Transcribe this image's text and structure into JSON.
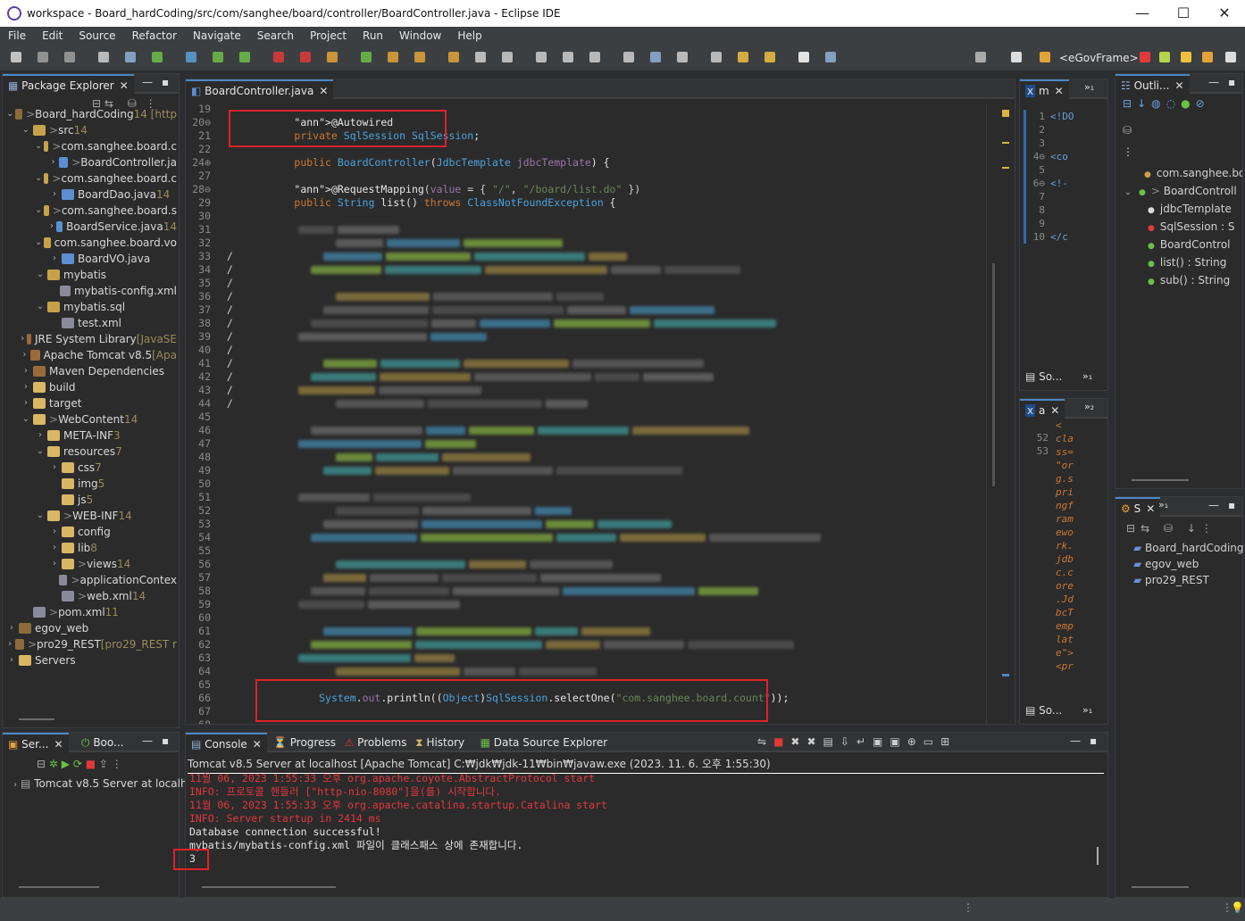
{
  "window": {
    "title": "workspace - Board_hardCoding/src/com/sanghee/board/controller/BoardController.java - Eclipse IDE",
    "min": "—",
    "max": "☐",
    "close": "✕"
  },
  "menu": [
    "File",
    "Edit",
    "Source",
    "Refactor",
    "Navigate",
    "Search",
    "Project",
    "Run",
    "Window",
    "Help"
  ],
  "toolbar": {
    "perspective": "<eGovFrame>"
  },
  "package_explorer": {
    "title": "Package Explorer",
    "items": [
      {
        "d": 0,
        "tw": "v",
        "icon": "proj",
        "dec": ">",
        "label": "Board_hardCoding",
        "suffix": " 14 [http"
      },
      {
        "d": 1,
        "tw": "v",
        "icon": "pkg",
        "dec": ">",
        "label": "src",
        "suffix": " 14"
      },
      {
        "d": 2,
        "tw": "v",
        "icon": "pkg",
        "dec": ">",
        "label": "com.sanghee.board.c",
        "suffix": ""
      },
      {
        "d": 3,
        "tw": ">",
        "icon": "java",
        "dec": ">",
        "label": "BoardController.ja",
        "suffix": ""
      },
      {
        "d": 2,
        "tw": "v",
        "icon": "pkg",
        "dec": ">",
        "label": "com.sanghee.board.c",
        "suffix": ""
      },
      {
        "d": 3,
        "tw": ">",
        "icon": "java",
        "dec": "",
        "label": "BoardDao.java",
        "suffix": " 14"
      },
      {
        "d": 2,
        "tw": "v",
        "icon": "pkg",
        "dec": ">",
        "label": "com.sanghee.board.s",
        "suffix": ""
      },
      {
        "d": 3,
        "tw": ">",
        "icon": "java",
        "dec": "",
        "label": "BoardService.java",
        "suffix": " 14"
      },
      {
        "d": 2,
        "tw": "v",
        "icon": "pkg",
        "dec": "",
        "label": "com.sanghee.board.vo",
        "suffix": ""
      },
      {
        "d": 3,
        "tw": ">",
        "icon": "java",
        "dec": "",
        "label": "BoardVO.java",
        "suffix": ""
      },
      {
        "d": 2,
        "tw": "v",
        "icon": "pkg",
        "dec": "",
        "label": "mybatis",
        "suffix": ""
      },
      {
        "d": 3,
        "tw": "",
        "icon": "xml",
        "dec": "",
        "label": "mybatis-config.xml",
        "suffix": ""
      },
      {
        "d": 2,
        "tw": "v",
        "icon": "pkg",
        "dec": "",
        "label": "mybatis.sql",
        "suffix": ""
      },
      {
        "d": 3,
        "tw": "",
        "icon": "xml",
        "dec": "",
        "label": "test.xml",
        "suffix": ""
      },
      {
        "d": 1,
        "tw": ">",
        "icon": "lib",
        "dec": "",
        "label": "JRE System Library",
        "suffix": " [JavaSE"
      },
      {
        "d": 1,
        "tw": ">",
        "icon": "lib",
        "dec": "",
        "label": "Apache Tomcat v8.5",
        "suffix": " [Apa"
      },
      {
        "d": 1,
        "tw": ">",
        "icon": "lib",
        "dec": "",
        "label": "Maven Dependencies",
        "suffix": ""
      },
      {
        "d": 1,
        "tw": ">",
        "icon": "fold",
        "dec": "",
        "label": "build",
        "suffix": ""
      },
      {
        "d": 1,
        "tw": ">",
        "icon": "fold",
        "dec": "",
        "label": "target",
        "suffix": ""
      },
      {
        "d": 1,
        "tw": "v",
        "icon": "fold",
        "dec": ">",
        "label": "WebContent",
        "suffix": " 14"
      },
      {
        "d": 2,
        "tw": ">",
        "icon": "fold",
        "dec": "",
        "label": "META-INF",
        "suffix": " 3"
      },
      {
        "d": 2,
        "tw": "v",
        "icon": "fold",
        "dec": "",
        "label": "resources",
        "suffix": " 7"
      },
      {
        "d": 3,
        "tw": ">",
        "icon": "fold",
        "dec": "",
        "label": "css",
        "suffix": " 7"
      },
      {
        "d": 3,
        "tw": "",
        "icon": "fold",
        "dec": "",
        "label": "img",
        "suffix": " 5"
      },
      {
        "d": 3,
        "tw": "",
        "icon": "fold",
        "dec": "",
        "label": "js",
        "suffix": " 5"
      },
      {
        "d": 2,
        "tw": "v",
        "icon": "fold",
        "dec": ">",
        "label": "WEB-INF",
        "suffix": " 14"
      },
      {
        "d": 3,
        "tw": ">",
        "icon": "fold",
        "dec": "",
        "label": "config",
        "suffix": ""
      },
      {
        "d": 3,
        "tw": ">",
        "icon": "fold",
        "dec": "",
        "label": "lib",
        "suffix": " 8"
      },
      {
        "d": 3,
        "tw": ">",
        "icon": "fold",
        "dec": ">",
        "label": "views",
        "suffix": " 14"
      },
      {
        "d": 3,
        "tw": "",
        "icon": "xml",
        "dec": ">",
        "label": "applicationContex",
        "suffix": ""
      },
      {
        "d": 3,
        "tw": "",
        "icon": "xml",
        "dec": ">",
        "label": "web.xml",
        "suffix": " 14"
      },
      {
        "d": 1,
        "tw": "",
        "icon": "xml",
        "dec": ">",
        "label": "pom.xml",
        "suffix": " 11"
      },
      {
        "d": 0,
        "tw": ">",
        "icon": "proj",
        "dec": "",
        "label": "egov_web",
        "suffix": ""
      },
      {
        "d": 0,
        "tw": ">",
        "icon": "proj",
        "dec": ">",
        "label": "pro29_REST",
        "suffix": " [pro29_REST r"
      },
      {
        "d": 0,
        "tw": ">",
        "icon": "fold",
        "dec": "",
        "label": "Servers",
        "suffix": ""
      }
    ]
  },
  "servers_panel": {
    "tab1": "Ser...",
    "tab2": "Boo...",
    "item": "Tomcat v8.5 Server at localh"
  },
  "editor": {
    "tab": "BoardController.java",
    "lines_top": [
      {
        "n": "19",
        "code": ""
      },
      {
        "n": "20⊖",
        "code": "@Autowired",
        "cls": "ann"
      },
      {
        "n": "21",
        "code": "private SqlSession SqlSession;",
        "cls": "field"
      },
      {
        "n": "22",
        "code": ""
      },
      {
        "n": "24⊕",
        "code": "public BoardController(JdbcTemplate jdbcTemplate) {",
        "cls": "ctor"
      },
      {
        "n": "27",
        "code": ""
      },
      {
        "n": "28⊖",
        "code": "@RequestMapping(value = { \"/\", \"/board/list.do\" })",
        "cls": "map"
      },
      {
        "n": "29",
        "code": "public String list() throws ClassNotFoundException {",
        "cls": "list"
      },
      {
        "n": "30",
        "code": ""
      }
    ],
    "blur_line_numbers": [
      "31",
      "32",
      "33",
      "34",
      "35",
      "36",
      "37",
      "38",
      "39",
      "40",
      "41",
      "42",
      "43",
      "44",
      "45",
      "46",
      "47",
      "48",
      "49",
      "50",
      "51",
      "52",
      "53",
      "54",
      "55",
      "56",
      "57",
      "58",
      "59",
      "60",
      "61",
      "62",
      "63",
      "64",
      "65"
    ],
    "lines_bottom": [
      {
        "n": "66",
        "code": "System.out.println((Object)SqlSession.selectOne(\"com.sanghee.board.count\"));"
      },
      {
        "n": "67",
        "code": ""
      },
      {
        "n": "68",
        "code": ""
      }
    ]
  },
  "mini_editor_m": {
    "tab": "m",
    "lines": [
      "1",
      "2",
      "3",
      "4⊖",
      "5",
      "6⊖",
      "7",
      "8",
      "9",
      "10"
    ],
    "codes": [
      "<!DO",
      "",
      "",
      "<co",
      "",
      "<!-",
      "",
      "",
      "",
      "</c"
    ],
    "footer": "So..."
  },
  "mini_editor_a": {
    "tab": "a",
    "lines": [
      "52",
      "",
      "",
      "",
      "",
      "",
      "",
      "",
      "",
      "",
      "",
      "",
      "",
      "",
      "",
      "",
      "",
      "53"
    ],
    "codes": [
      "<",
      "cla",
      "ss=",
      "\"or",
      "g.s",
      "pri",
      "ngf",
      "ram",
      "ewo",
      "rk.",
      "jdb",
      "c.c",
      "ore",
      ".Jd",
      "bcT",
      "emp",
      "lat",
      "e\">",
      "",
      "<pr"
    ],
    "footer": "So..."
  },
  "outline": {
    "title": "Outli...",
    "items": [
      {
        "d": 0,
        "label": "com.sanghee.bo"
      },
      {
        "d": 0,
        "label": "BoardControll",
        "dec": ">"
      },
      {
        "d": 1,
        "label": "jdbcTemplate"
      },
      {
        "d": 1,
        "label": "SqlSession : S"
      },
      {
        "d": 1,
        "label": "BoardControl"
      },
      {
        "d": 1,
        "label": "list() : String"
      },
      {
        "d": 1,
        "label": "sub() : String"
      }
    ]
  },
  "servers_right": {
    "title": "S",
    "items": [
      "Board_hardCoding",
      "egov_web",
      "pro29_REST"
    ]
  },
  "console": {
    "tabs": [
      "Console",
      "Progress",
      "Problems",
      "History",
      "Data Source Explorer"
    ],
    "header": "Tomcat v8.5 Server at localhost [Apache Tomcat] C:₩jdk₩jdk-11₩bin₩javaw.exe  (2023. 11. 6. 오후 1:55:30)",
    "lines": [
      {
        "t": "11월 06, 2023 1:55:33 오후 org.apache.coyote.AbstractProtocol start",
        "c": "red"
      },
      {
        "t": "INFO: 프로토콜 핸들러 [\"http-nio-8080\"]을(를) 시작합니다.",
        "c": "red"
      },
      {
        "t": "11월 06, 2023 1:55:33 오후 org.apache.catalina.startup.Catalina start",
        "c": "red"
      },
      {
        "t": "INFO: Server startup in 2414 ms",
        "c": "red"
      },
      {
        "t": "Database connection successful!",
        "c": "wt"
      },
      {
        "t": "mybatis/mybatis-config.xml 파일이 클래스패스 상에 존재합니다.",
        "c": "wt"
      },
      {
        "t": "3",
        "c": "wt"
      }
    ]
  }
}
